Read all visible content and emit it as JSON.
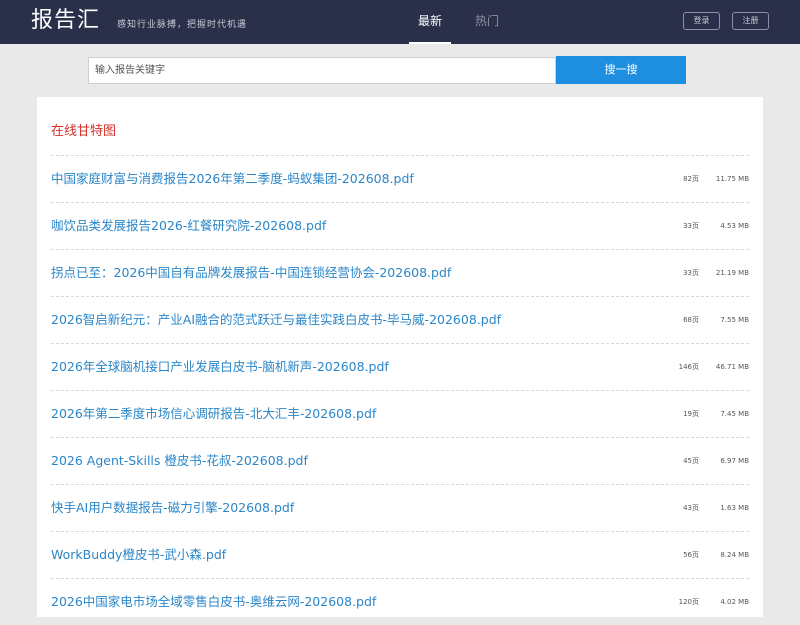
{
  "header": {
    "logo": "报告汇",
    "slogan": "感知行业脉搏，把握时代机遇",
    "tabs": [
      {
        "label": "最新",
        "active": true
      },
      {
        "label": "热门",
        "active": false
      }
    ],
    "login_label": "登录",
    "register_label": "注册",
    "background_color": "#2a3049"
  },
  "search": {
    "placeholder": "输入报告关键字",
    "button_label": "搜一搜",
    "button_color": "#1e8fe0"
  },
  "section": {
    "title": "在线甘特图",
    "title_color": "#d3302a"
  },
  "reports": [
    {
      "title": "中国家庭财富与消费报告2026年第二季度-蚂蚁集团-202608.pdf",
      "pages": "82页",
      "size": "11.75 MB"
    },
    {
      "title": "咖饮品类发展报告2026-红餐研究院-202608.pdf",
      "pages": "33页",
      "size": "4.53 MB"
    },
    {
      "title": "拐点已至：2026中国自有品牌发展报告-中国连锁经营协会-202608.pdf",
      "pages": "33页",
      "size": "21.19 MB"
    },
    {
      "title": "2026智启新纪元：产业AI融合的范式跃迁与最佳实践白皮书-毕马威-202608.pdf",
      "pages": "68页",
      "size": "7.55 MB"
    },
    {
      "title": "2026年全球脑机接口产业发展白皮书-脑机新声-202608.pdf",
      "pages": "146页",
      "size": "46.71 MB"
    },
    {
      "title": "2026年第二季度市场信心调研报告-北大汇丰-202608.pdf",
      "pages": "19页",
      "size": "7.45 MB"
    },
    {
      "title": "2026 Agent-Skills 橙皮书-花叔-202608.pdf",
      "pages": "45页",
      "size": "6.97 MB"
    },
    {
      "title": "快手AI用户数据报告-磁力引擎-202608.pdf",
      "pages": "43页",
      "size": "1.63 MB"
    },
    {
      "title": "WorkBuddy橙皮书-武小森.pdf",
      "pages": "56页",
      "size": "8.24 MB"
    },
    {
      "title": "2026中国家电市场全域零售白皮书-奥维云网-202608.pdf",
      "pages": "120页",
      "size": "4.02 MB"
    }
  ],
  "colors": {
    "link": "#2a86c8",
    "page_background": "#e9e9e9"
  }
}
